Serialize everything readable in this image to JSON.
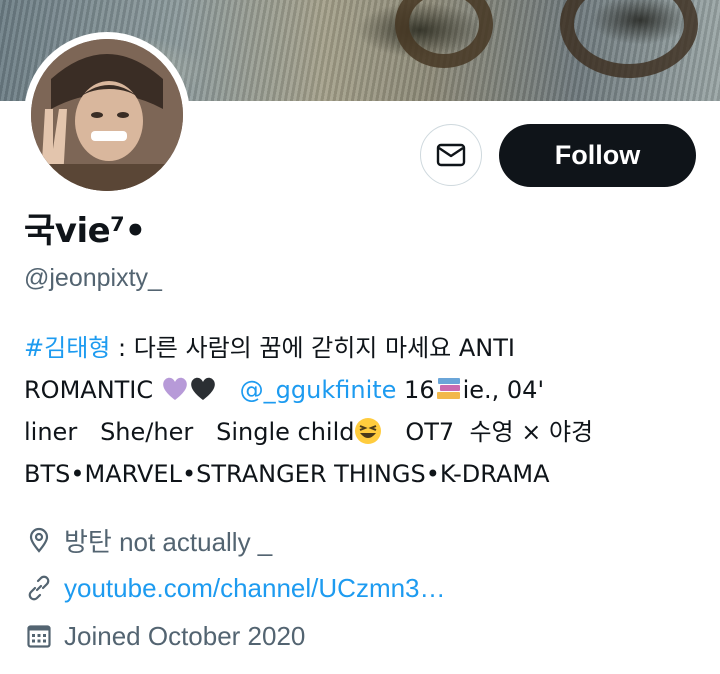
{
  "profile": {
    "display_name": "국vie⁷•",
    "handle": "@jeonpixty_",
    "follow_label": "Follow",
    "message_icon": "envelope-icon",
    "bio": {
      "hashtag": "#김태형",
      "part1": " : 다른 사람의 꿈에 갇히지 마세요 ANTI",
      "part2": "ROMANTIC ",
      "mention": "@_ggukfinite",
      "part3": " 16",
      "part4": "ie., 04'",
      "part5": "liner   She/her   Single child",
      "part6": "   OT7  수영 × 야경",
      "part7": "BTS•MARVEL•STRANGER THINGS•K-DRAMA",
      "emojis": [
        "purple-heart",
        "black-heart",
        "books",
        "grinning-squinting-face"
      ]
    },
    "location": "방탄 not actually _",
    "website": "youtube.com/channel/UCzmn3…",
    "joined": "Joined October 2020"
  },
  "colors": {
    "accent": "#1d9bf0",
    "muted": "#536471",
    "text": "#0f1419",
    "follow_bg": "#0f1419"
  }
}
